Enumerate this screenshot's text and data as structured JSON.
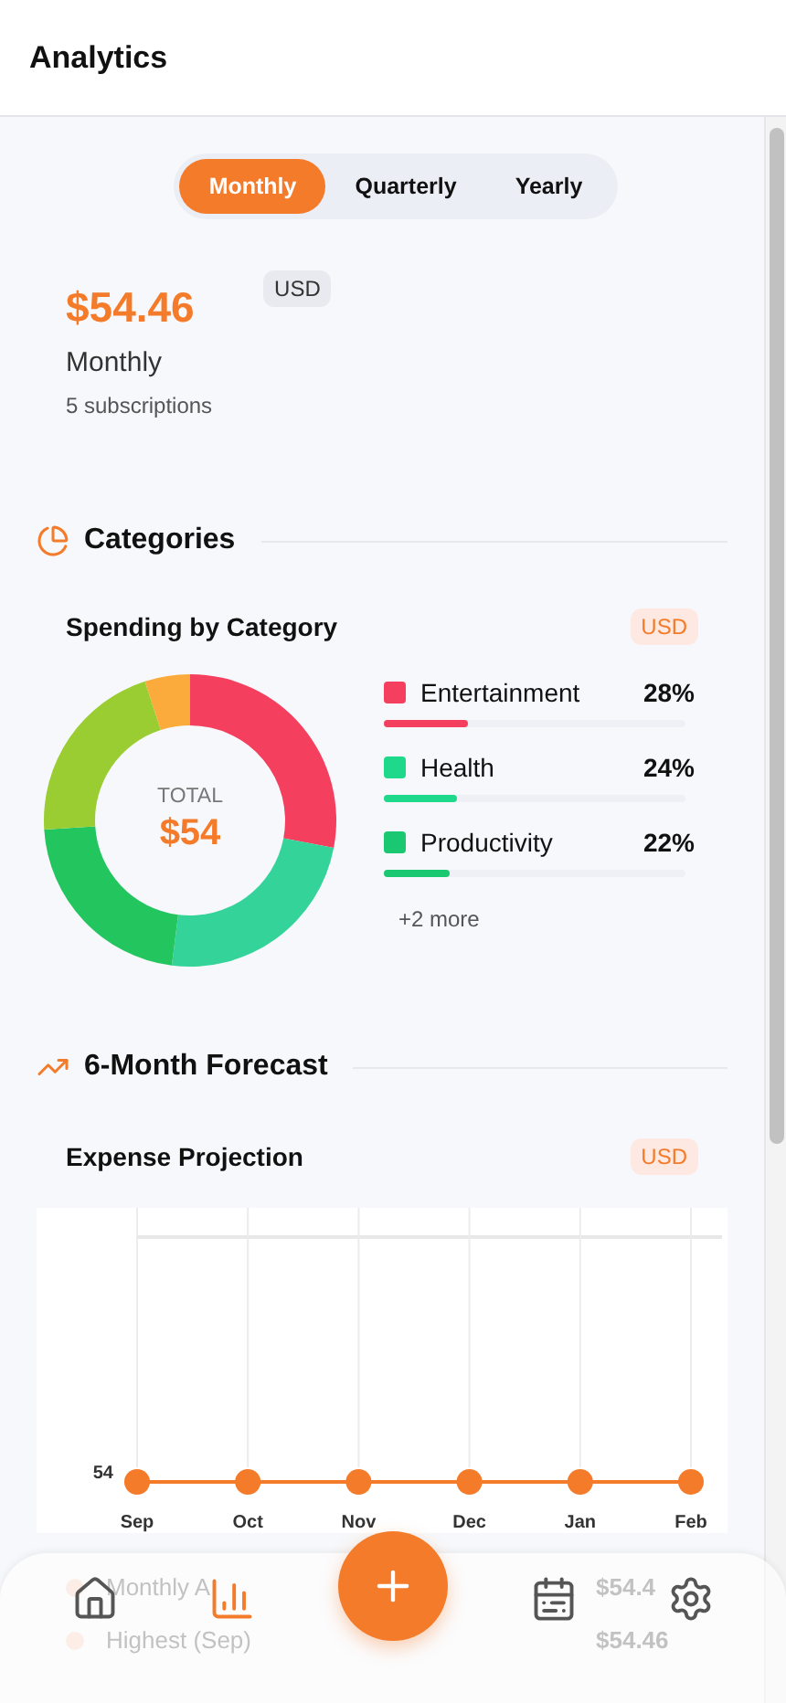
{
  "header": {
    "title": "Analytics"
  },
  "period_tabs": [
    {
      "label": "Monthly",
      "selected": true
    },
    {
      "label": "Quarterly",
      "selected": false
    },
    {
      "label": "Yearly",
      "selected": false
    }
  ],
  "summary": {
    "amount": "$54.46",
    "currency": "USD",
    "period": "Monthly",
    "count": "5 subscriptions"
  },
  "categories": {
    "heading": "Categories",
    "card_title": "Spending by Category",
    "currency": "USD",
    "total_label": "TOTAL",
    "total": "$54",
    "legend": [
      {
        "label": "Entertainment",
        "percent": "28%",
        "color": "#f43f5e",
        "level": 0.28
      },
      {
        "label": "Health",
        "percent": "24%",
        "color": "#1ed98a",
        "level": 0.24
      },
      {
        "label": "Productivity",
        "percent": "22%",
        "color": "#19c870",
        "level": 0.22
      }
    ],
    "more": "+2 more"
  },
  "forecast": {
    "heading": "6-Month Forecast",
    "card_title": "Expense Projection",
    "currency": "USD",
    "y_label": "54",
    "x_labels": [
      "Sep",
      "Oct",
      "Nov",
      "Dec",
      "Jan",
      "Feb"
    ],
    "stats": [
      {
        "label": "Monthly A",
        "value": "$54.4"
      },
      {
        "label": "Highest (Sep)",
        "value": "$54.46"
      }
    ]
  },
  "nav": [
    {
      "kind": "home",
      "selected": false
    },
    {
      "kind": "analytics",
      "selected": true
    },
    {
      "kind": "add"
    },
    {
      "kind": "calendar",
      "selected": false
    },
    {
      "kind": "settings",
      "selected": false
    }
  ]
}
